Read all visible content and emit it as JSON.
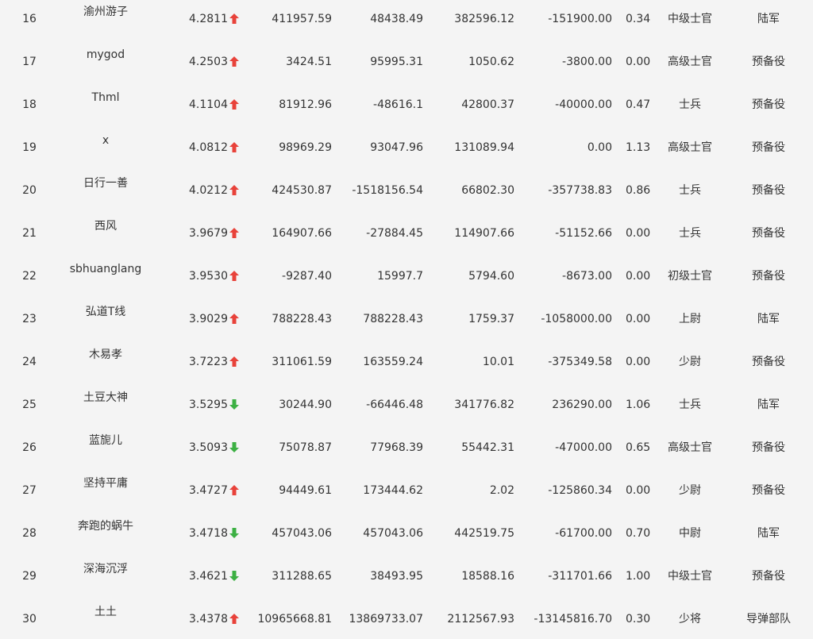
{
  "colors": {
    "background": "#f4f4f4",
    "text": "#333333",
    "arrow_up": "#e8423a",
    "arrow_down": "#3cb043"
  },
  "rows": [
    {
      "rank": "16",
      "name": "渝州游子",
      "score": "4.2811",
      "trend": "up",
      "v1": "411957.59",
      "v2": "48438.49",
      "v3": "382596.12",
      "v4": "-151900.00",
      "ratio": "0.34",
      "rank_title": "中级士官",
      "unit": "陆军"
    },
    {
      "rank": "17",
      "name": "mygod",
      "score": "4.2503",
      "trend": "up",
      "v1": "3424.51",
      "v2": "95995.31",
      "v3": "1050.62",
      "v4": "-3800.00",
      "ratio": "0.00",
      "rank_title": "高级士官",
      "unit": "预备役"
    },
    {
      "rank": "18",
      "name": "Thml",
      "score": "4.1104",
      "trend": "up",
      "v1": "81912.96",
      "v2": "-48616.1",
      "v3": "42800.37",
      "v4": "-40000.00",
      "ratio": "0.47",
      "rank_title": "士兵",
      "unit": "预备役"
    },
    {
      "rank": "19",
      "name": "x",
      "score": "4.0812",
      "trend": "up",
      "v1": "98969.29",
      "v2": "93047.96",
      "v3": "131089.94",
      "v4": "0.00",
      "ratio": "1.13",
      "rank_title": "高级士官",
      "unit": "预备役"
    },
    {
      "rank": "20",
      "name": "日行一善",
      "score": "4.0212",
      "trend": "up",
      "v1": "424530.87",
      "v2": "-1518156.54",
      "v3": "66802.30",
      "v4": "-357738.83",
      "ratio": "0.86",
      "rank_title": "士兵",
      "unit": "预备役"
    },
    {
      "rank": "21",
      "name": "西风",
      "score": "3.9679",
      "trend": "up",
      "v1": "164907.66",
      "v2": "-27884.45",
      "v3": "114907.66",
      "v4": "-51152.66",
      "ratio": "0.00",
      "rank_title": "士兵",
      "unit": "预备役"
    },
    {
      "rank": "22",
      "name": "sbhuanglang",
      "score": "3.9530",
      "trend": "up",
      "v1": "-9287.40",
      "v2": "15997.7",
      "v3": "5794.60",
      "v4": "-8673.00",
      "ratio": "0.00",
      "rank_title": "初级士官",
      "unit": "预备役"
    },
    {
      "rank": "23",
      "name": "弘道T线",
      "score": "3.9029",
      "trend": "up",
      "v1": "788228.43",
      "v2": "788228.43",
      "v3": "1759.37",
      "v4": "-1058000.00",
      "ratio": "0.00",
      "rank_title": "上尉",
      "unit": "陆军"
    },
    {
      "rank": "24",
      "name": "木易孝",
      "score": "3.7223",
      "trend": "up",
      "v1": "311061.59",
      "v2": "163559.24",
      "v3": "10.01",
      "v4": "-375349.58",
      "ratio": "0.00",
      "rank_title": "少尉",
      "unit": "预备役"
    },
    {
      "rank": "25",
      "name": "土豆大神",
      "score": "3.5295",
      "trend": "down",
      "v1": "30244.90",
      "v2": "-66446.48",
      "v3": "341776.82",
      "v4": "236290.00",
      "ratio": "1.06",
      "rank_title": "士兵",
      "unit": "陆军"
    },
    {
      "rank": "26",
      "name": "蓝旎儿",
      "score": "3.5093",
      "trend": "down",
      "v1": "75078.87",
      "v2": "77968.39",
      "v3": "55442.31",
      "v4": "-47000.00",
      "ratio": "0.65",
      "rank_title": "高级士官",
      "unit": "预备役"
    },
    {
      "rank": "27",
      "name": "坚持平庸",
      "score": "3.4727",
      "trend": "up",
      "v1": "94449.61",
      "v2": "173444.62",
      "v3": "2.02",
      "v4": "-125860.34",
      "ratio": "0.00",
      "rank_title": "少尉",
      "unit": "预备役"
    },
    {
      "rank": "28",
      "name": "奔跑的蜗牛",
      "score": "3.4718",
      "trend": "down",
      "v1": "457043.06",
      "v2": "457043.06",
      "v3": "442519.75",
      "v4": "-61700.00",
      "ratio": "0.70",
      "rank_title": "中尉",
      "unit": "陆军"
    },
    {
      "rank": "29",
      "name": "深海沉浮",
      "score": "3.4621",
      "trend": "down",
      "v1": "311288.65",
      "v2": "38493.95",
      "v3": "18588.16",
      "v4": "-311701.66",
      "ratio": "1.00",
      "rank_title": "中级士官",
      "unit": "预备役"
    },
    {
      "rank": "30",
      "name": "土土",
      "score": "3.4378",
      "trend": "up",
      "v1": "10965668.81",
      "v2": "13869733.07",
      "v3": "2112567.93",
      "v4": "-13145816.70",
      "ratio": "0.30",
      "rank_title": "少将",
      "unit": "导弹部队"
    }
  ]
}
